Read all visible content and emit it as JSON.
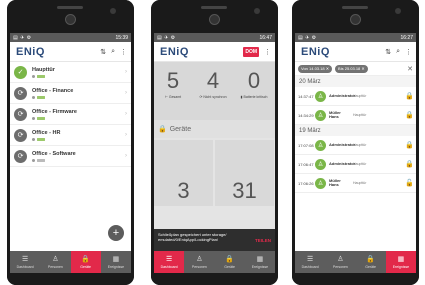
{
  "phone1": {
    "status_time": "15:39",
    "logo": "ENiQ",
    "devices": [
      {
        "name": "Haupttür",
        "state": "ok"
      },
      {
        "name": "Office - Finance",
        "state": "sync"
      },
      {
        "name": "Office - Firmware",
        "state": "sync"
      },
      {
        "name": "Office - HR",
        "state": "sync"
      },
      {
        "name": "Office - Software",
        "state": "sync"
      }
    ],
    "fab": "+",
    "nav": [
      {
        "label": "Dashboard",
        "icon": "☰"
      },
      {
        "label": "Personen",
        "icon": "♙"
      },
      {
        "label": "Geräte",
        "icon": "🔒"
      },
      {
        "label": "Ereignisse",
        "icon": "▦"
      }
    ],
    "active_nav": 2
  },
  "phone2": {
    "status_time": "16:47",
    "logo": "ENiQ",
    "badge": "DOM",
    "stats": [
      {
        "value": "5",
        "label": "Gesamt"
      },
      {
        "value": "4",
        "label": "Nicht synchron"
      },
      {
        "value": "0",
        "label": "Batterie kritisch"
      }
    ],
    "section": "Geräte",
    "tiles": [
      "3",
      "31"
    ],
    "toast_text": "Schließplan gespeichert unter storage/ emulated/0/EniqApp/LockingPlan/",
    "toast_action": "TEILEN",
    "nav": [
      {
        "label": "Dashboard",
        "icon": "☰"
      },
      {
        "label": "Personen",
        "icon": "♙"
      },
      {
        "label": "Geräte",
        "icon": "🔒"
      },
      {
        "label": "Ereignisse",
        "icon": "▦"
      }
    ],
    "active_nav": 0
  },
  "phone3": {
    "status_time": "16:27",
    "logo": "ENiQ",
    "chips": [
      "Von 14.03.18",
      "Bis 25.03.18"
    ],
    "groups": [
      {
        "date": "20 März",
        "events": [
          {
            "time": "14:37:47",
            "user": "Administrator",
            "door": "Haupttür",
            "lock": "closed"
          },
          {
            "time": "14:34:29",
            "user": "Müller Hans",
            "door": "Haupttür",
            "lock": "denied"
          }
        ]
      },
      {
        "date": "19 März",
        "events": [
          {
            "time": "17:07:08",
            "user": "Administrator",
            "door": "Haupttür",
            "lock": "closed"
          },
          {
            "time": "17:06:47",
            "user": "Administrator",
            "door": "Haupttür",
            "lock": "closed"
          },
          {
            "time": "17:06:26",
            "user": "Müller Hans",
            "door": "Haupttür",
            "lock": "open"
          }
        ]
      }
    ],
    "nav": [
      {
        "label": "Dashboard",
        "icon": "☰"
      },
      {
        "label": "Personen",
        "icon": "♙"
      },
      {
        "label": "Geräte",
        "icon": "🔒"
      },
      {
        "label": "Ereignisse",
        "icon": "▦"
      }
    ],
    "active_nav": 3
  },
  "colors": {
    "accent": "#e2294a",
    "ok": "#7ab648",
    "navbar": "#5d5d5d",
    "logo": "#2c4b7a"
  }
}
